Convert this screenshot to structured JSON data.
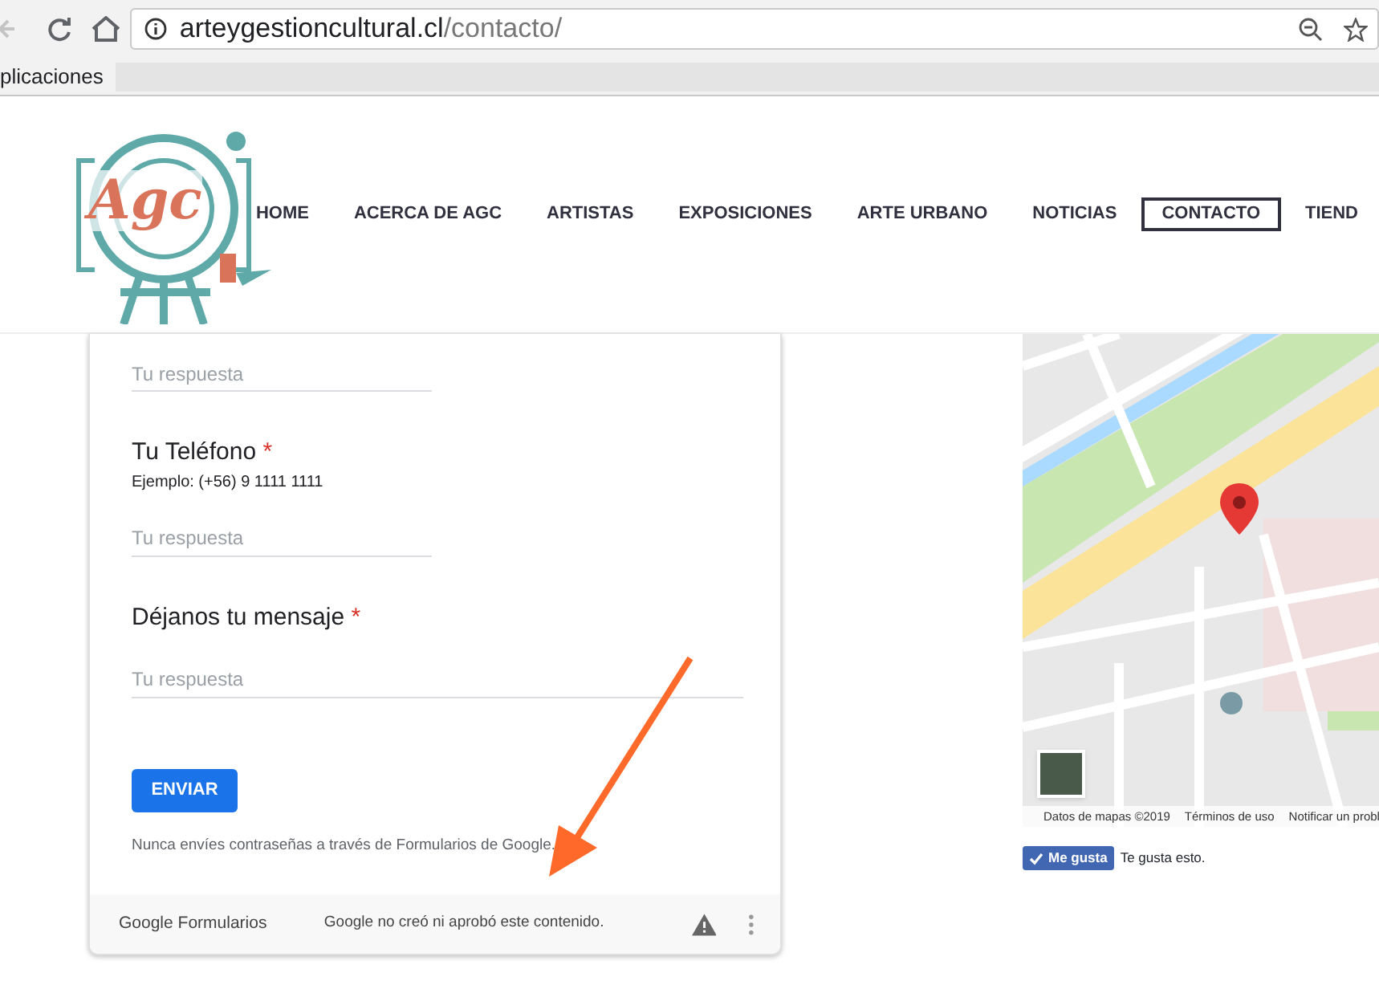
{
  "browser": {
    "url_domain": "arteygestioncultural.cl",
    "url_path": "/contacto/",
    "bookmarks": [
      "plicaciones"
    ]
  },
  "logo": {
    "text": "Agc"
  },
  "nav": [
    {
      "label": "HOME",
      "selected": false
    },
    {
      "label": "ACERCA DE AGC",
      "selected": false
    },
    {
      "label": "ARTISTAS",
      "selected": false
    },
    {
      "label": "EXPOSICIONES",
      "selected": false
    },
    {
      "label": "ARTE URBANO",
      "selected": false
    },
    {
      "label": "NOTICIAS",
      "selected": false
    },
    {
      "label": "CONTACTO",
      "selected": true
    },
    {
      "label": "TIEND",
      "selected": false
    }
  ],
  "form": {
    "required_mark": "*",
    "first_field": {
      "placeholder": "Tu respuesta"
    },
    "questions": [
      {
        "label": "Tu Teléfono",
        "required": true,
        "hint": "Ejemplo: (+56) 9 1111 1111",
        "kind": "short",
        "placeholder": "Tu respuesta"
      },
      {
        "label": "Déjanos tu mensaje",
        "required": true,
        "kind": "long",
        "placeholder": "Tu respuesta"
      }
    ],
    "submit": "ENVIAR",
    "note": "Nunca envíes contraseñas a través de Formularios de Google.",
    "footer": {
      "brand": "Google Formularios",
      "notice": "Google no creó ni aprobó este contenido."
    }
  },
  "map": {
    "kind": "picture",
    "attribution": [
      "Datos de mapas ©2019",
      "Términos de uso",
      "Notificar un probl"
    ]
  },
  "like": {
    "button": "Me gusta",
    "checked": true,
    "text": "Te gusta esto."
  }
}
